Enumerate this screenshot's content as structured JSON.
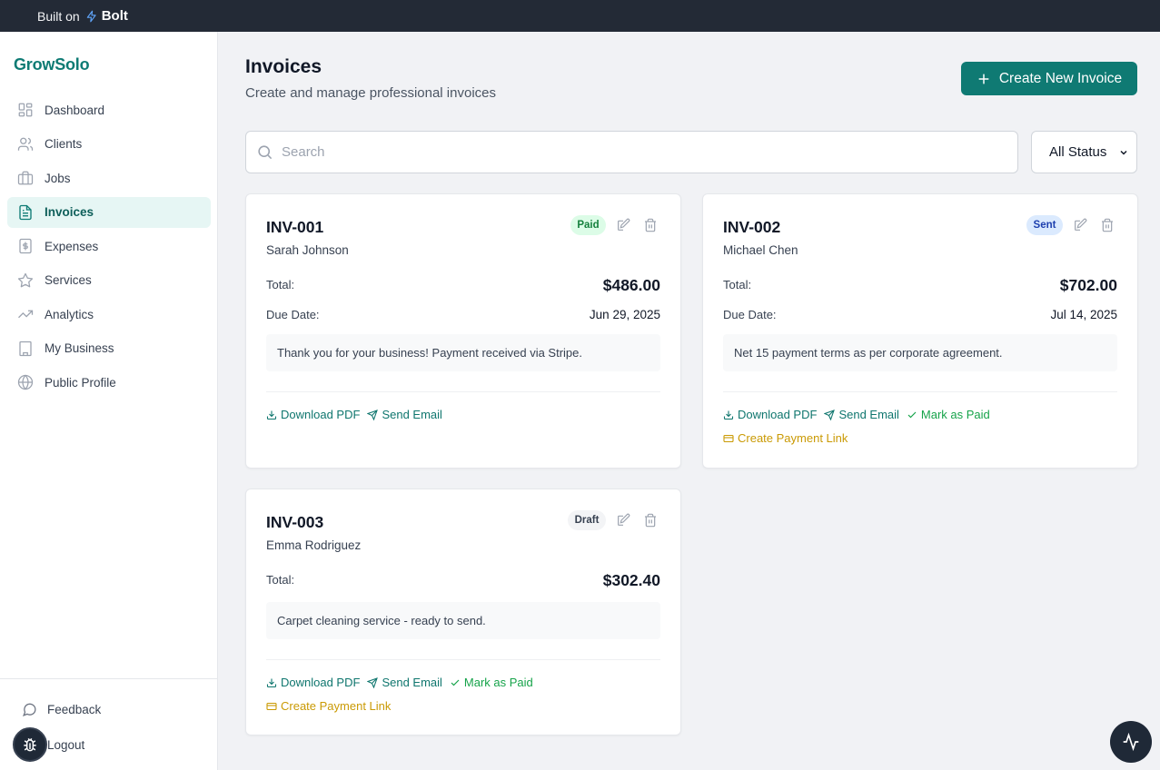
{
  "topbar": {
    "built_on": "Built on",
    "brand": "Bolt"
  },
  "sidebar": {
    "logo": "GrowSolo",
    "items": [
      {
        "label": "Dashboard",
        "icon": "dashboard-icon"
      },
      {
        "label": "Clients",
        "icon": "users-icon"
      },
      {
        "label": "Jobs",
        "icon": "briefcase-icon"
      },
      {
        "label": "Invoices",
        "icon": "file-text-icon",
        "active": true
      },
      {
        "label": "Expenses",
        "icon": "dollar-receipt-icon"
      },
      {
        "label": "Services",
        "icon": "star-icon"
      },
      {
        "label": "Analytics",
        "icon": "trending-up-icon"
      },
      {
        "label": "My Business",
        "icon": "building-icon"
      },
      {
        "label": "Public Profile",
        "icon": "globe-icon"
      }
    ],
    "feedback": "Feedback",
    "logout": "Logout"
  },
  "header": {
    "title": "Invoices",
    "subtitle": "Create and manage professional invoices",
    "create_button": "Create New Invoice"
  },
  "filters": {
    "search_placeholder": "Search",
    "search_value": "",
    "status_selected": "All Status"
  },
  "labels": {
    "total": "Total:",
    "due_date": "Due Date:",
    "download_pdf": "Download PDF",
    "send_email": "Send Email",
    "mark_as_paid": "Mark as Paid",
    "create_payment_link": "Create Payment Link"
  },
  "invoices": [
    {
      "id": "INV-001",
      "client": "Sarah Johnson",
      "status": "Paid",
      "status_color": "#dcfce7",
      "status_text_color": "#15803d",
      "total": "$486.00",
      "due_date": "Jun 29, 2025",
      "note": "Thank you for your business! Payment received via Stripe."
    },
    {
      "id": "INV-002",
      "client": "Michael Chen",
      "status": "Sent",
      "status_color": "#dbeafe",
      "status_text_color": "#1e40af",
      "total": "$702.00",
      "due_date": "Jul 14, 2025",
      "note": "Net 15 payment terms as per corporate agreement."
    },
    {
      "id": "INV-003",
      "client": "Emma Rodriguez",
      "status": "Draft",
      "status_color": "#f3f4f6",
      "status_text_color": "#374151",
      "total": "$302.40",
      "due_date": "",
      "note": "Carpet cleaning service - ready to send."
    }
  ],
  "colors": {
    "accent": "#0f7a73",
    "topbar": "#232a36",
    "green_action": "#16a34a",
    "amber_action": "#ca9a04"
  }
}
